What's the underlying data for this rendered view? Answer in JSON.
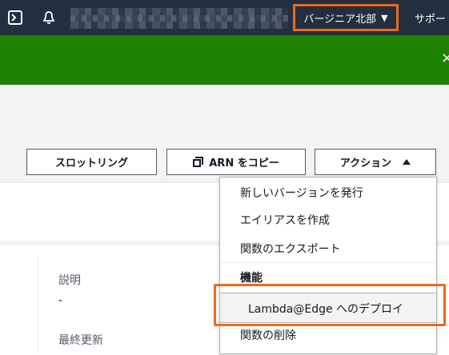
{
  "topnav": {
    "region_label": "バージニア北部",
    "support_label": "サポー"
  },
  "banner": {
    "close_glyph": "×"
  },
  "toolbar": {
    "throttle_label": "スロットリング",
    "copy_arn_label": "ARN をコピー",
    "actions_label": "アクション"
  },
  "actions_menu": {
    "items": [
      "新しいバージョンを発行",
      "エイリアスを作成",
      "関数のエクスポート"
    ],
    "group_label": "機能",
    "deploy_label": "Lambda@Edge へのデプロイ",
    "delete_label": "関数の削除"
  },
  "details": {
    "description_label": "説明",
    "description_value": "-",
    "last_modified_label": "最終更新"
  },
  "colors": {
    "nav_bg": "#232f3e",
    "banner_green": "#1d8102",
    "highlight_orange": "#ec6a1c"
  }
}
